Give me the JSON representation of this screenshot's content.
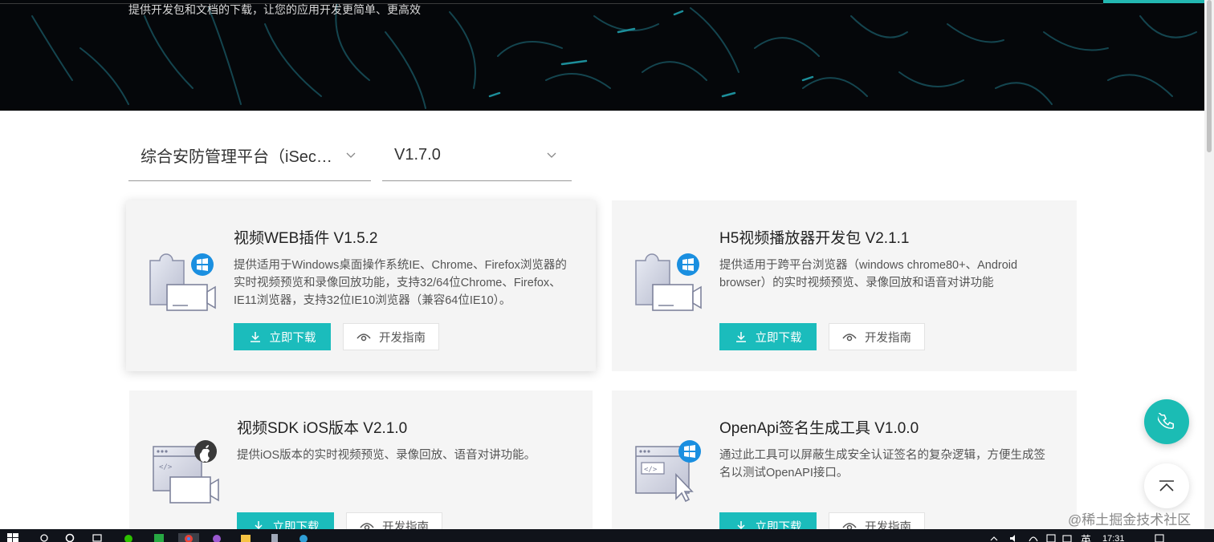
{
  "hero": {
    "subtitle": "提供开发包和文档的下载，让您的应用开发更简单、更高效"
  },
  "filters": {
    "product": "综合安防管理平台（iSecur...",
    "version": "V1.7.0"
  },
  "cards": [
    {
      "title": "视频WEB插件 V1.5.2",
      "desc": "提供适用于Windows桌面操作系统IE、Chrome、Firefox浏览器的实时视频预览和录像回放功能，支持32/64位Chrome、Firefox、IE11浏览器，支持32位IE10浏览器（兼容64位IE10）。",
      "download": "立即下载",
      "guide": "开发指南",
      "icon": "plugin-windows-icon"
    },
    {
      "title": "H5视频播放器开发包 V2.1.1",
      "desc": "提供适用于跨平台浏览器（windows chrome80+、Android browser）的实时视频预览、录像回放和语音对讲功能",
      "download": "立即下载",
      "guide": "开发指南",
      "icon": "plugin-windows-icon"
    },
    {
      "title": "视频SDK iOS版本 V2.1.0",
      "desc": "提供iOS版本的实时视频预览、录像回放、语音对讲功能。",
      "download": "立即下载",
      "guide": "开发指南",
      "icon": "sdk-apple-icon"
    },
    {
      "title": "OpenApi签名生成工具 V1.0.0",
      "desc": "通过此工具可以屏蔽生成安全认证签名的复杂逻辑，方便生成签名以测试OpenAPI接口。",
      "download": "立即下载",
      "guide": "开发指南",
      "icon": "tool-windows-icon"
    }
  ],
  "watermark": "@稀土掘金技术社区",
  "taskbar": {
    "ime": "英",
    "clock": "17:31"
  },
  "colors": {
    "accent": "#1bbcbc",
    "hero_bg": "#05070a",
    "card_bg": "#f5f5f5"
  }
}
